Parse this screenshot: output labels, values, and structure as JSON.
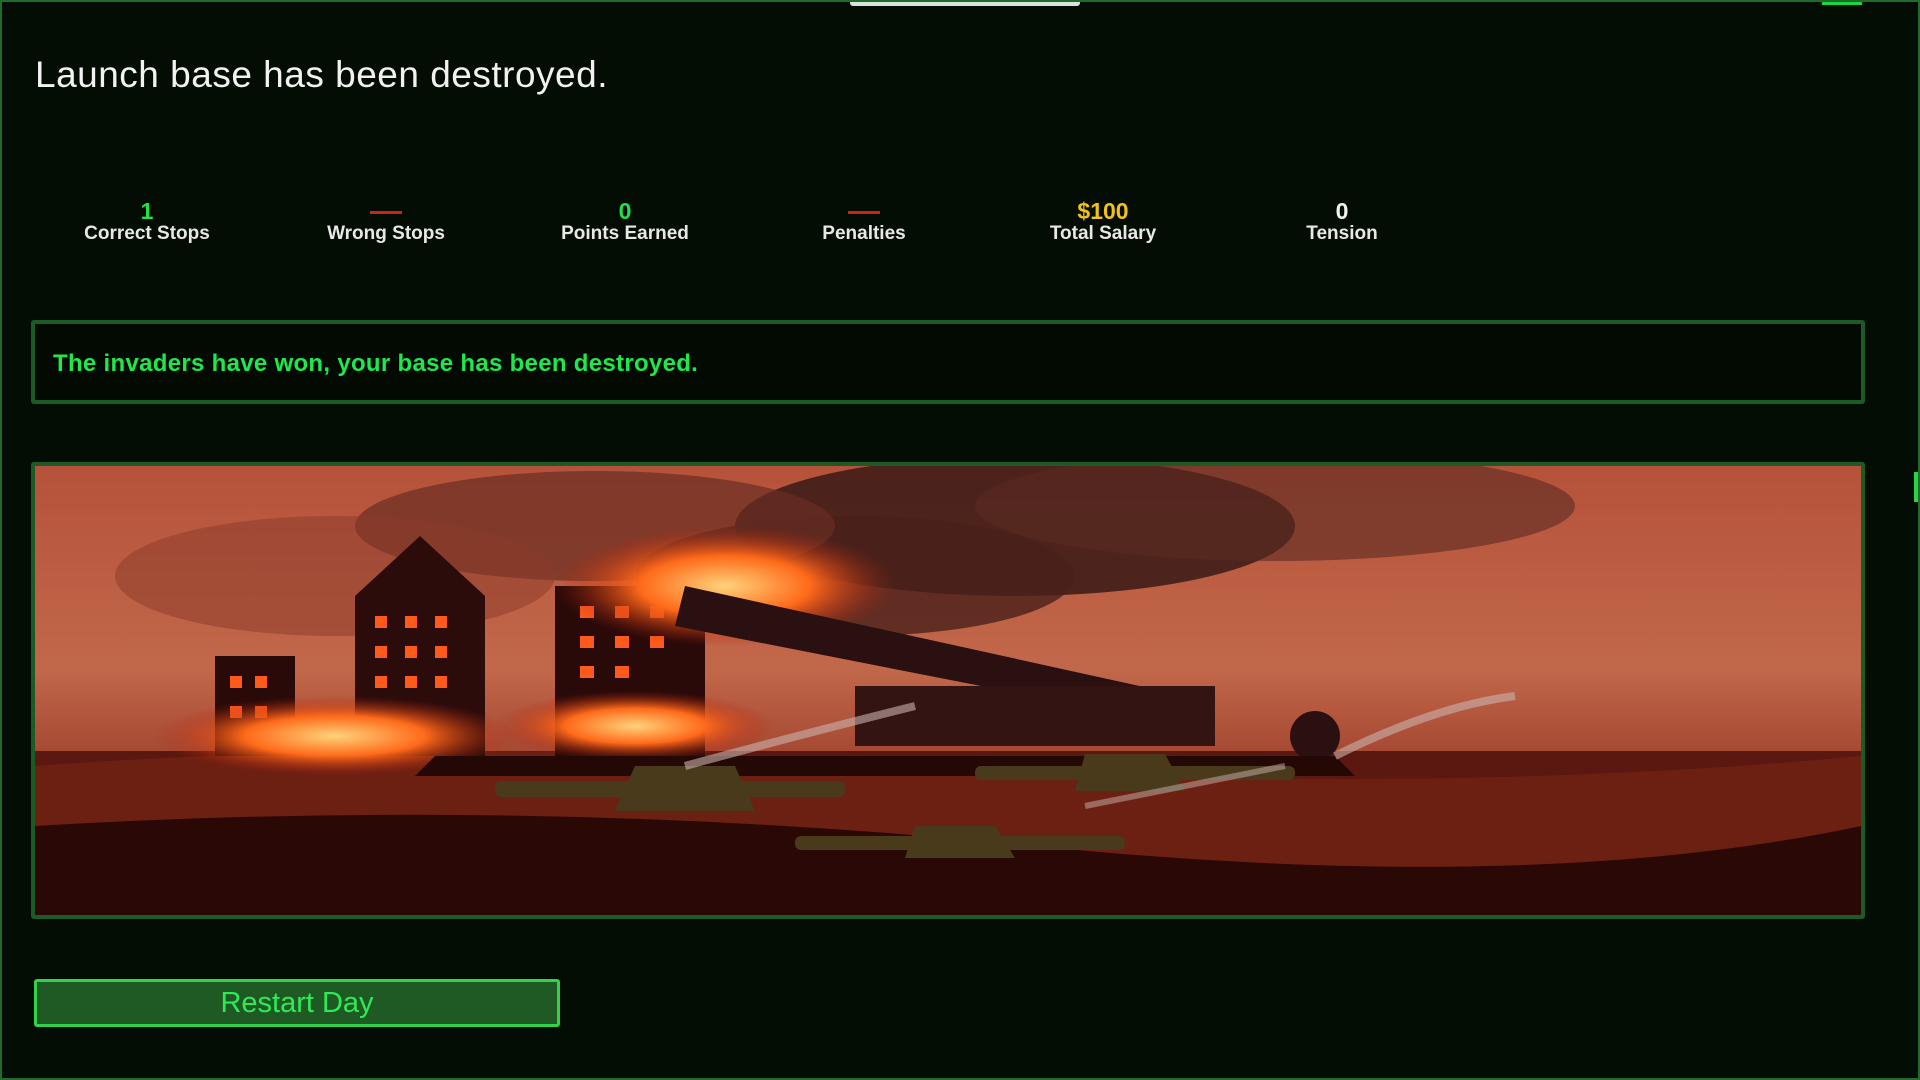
{
  "screen": {
    "title": "Launch base has been destroyed."
  },
  "stats": [
    {
      "value": "1",
      "label": "Correct Stops",
      "color": "#22e04a"
    },
    {
      "value": "",
      "label": "Wrong Stops",
      "color": "#c8261c",
      "dash": true
    },
    {
      "value": "0",
      "label": "Points Earned",
      "color": "#22e04a"
    },
    {
      "value": "",
      "label": "Penalties",
      "color": "#c8261c",
      "dash": true
    },
    {
      "value": "$100",
      "label": "Total Salary",
      "color": "#f2c21a"
    },
    {
      "value": "0",
      "label": "Tension",
      "color": "#f2f2f2"
    }
  ],
  "message": {
    "text": "The invaders have won, your base has been destroyed."
  },
  "scene": {
    "icon": "burning-base-illustration"
  },
  "actions": {
    "restart_label": "Restart Day"
  },
  "colors": {
    "accent": "#22e04a",
    "border": "#1c5a26",
    "background": "#030d03",
    "penalty": "#c8261c",
    "salary": "#f2c21a"
  }
}
